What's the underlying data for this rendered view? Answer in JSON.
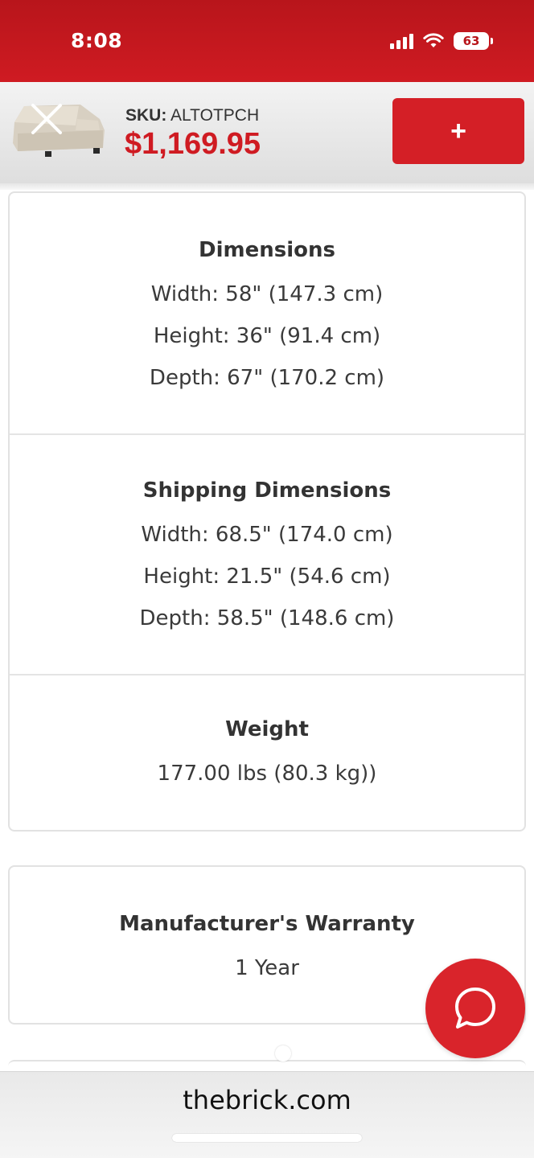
{
  "status_bar": {
    "time": "8:08",
    "battery": "63",
    "icons": [
      "signal-icon",
      "wifi-icon",
      "battery-icon"
    ]
  },
  "product_header": {
    "sku_label": "SKU:",
    "sku_value": "ALTOTPCH",
    "price": "$1,169.95",
    "add_label": "+",
    "thumbnail": "sofa-chaise-thumbnail",
    "close_icon": "close-icon"
  },
  "specs": {
    "dimensions": {
      "title": "Dimensions",
      "lines": [
        "Width: 58\" (147.3 cm)",
        "Height: 36\" (91.4 cm)",
        "Depth: 67\" (170.2 cm)"
      ]
    },
    "shipping_dimensions": {
      "title": "Shipping Dimensions",
      "lines": [
        "Width: 68.5\" (174.0 cm)",
        "Height: 21.5\" (54.6 cm)",
        "Depth: 58.5\" (148.6 cm)"
      ]
    },
    "weight": {
      "title": "Weight",
      "lines": [
        "177.00 lbs (80.3 kg))"
      ]
    }
  },
  "warranty": {
    "title": "Manufacturer's Warranty",
    "value": "1 Year"
  },
  "chat": {
    "icon": "chat-bubble-icon"
  },
  "browser": {
    "url": "thebrick.com"
  },
  "colors": {
    "brand_red": "#cf1b22",
    "button_red": "#d41f26",
    "text": "#333333",
    "border": "#e2e2e2"
  }
}
